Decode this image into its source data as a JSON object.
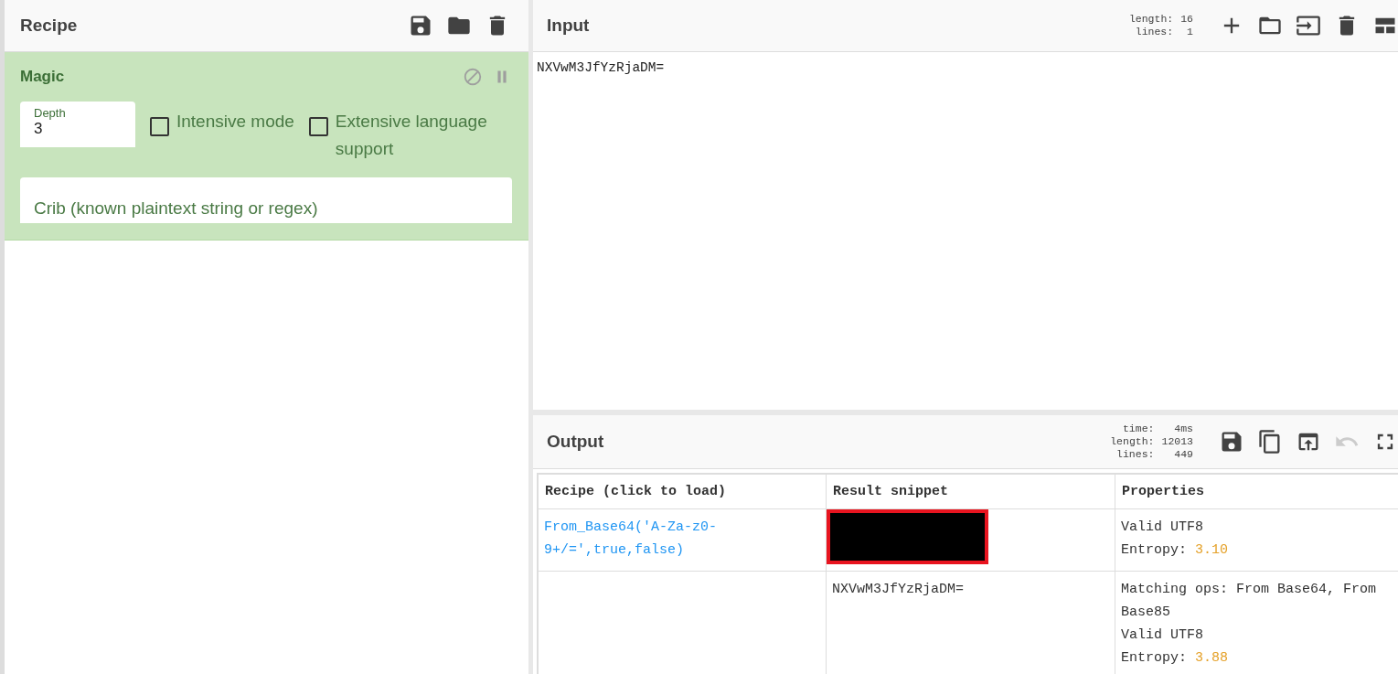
{
  "recipe": {
    "title": "Recipe",
    "operation": {
      "name": "Magic",
      "disabled": false,
      "paused": false,
      "depth": {
        "label": "Depth",
        "value": "3"
      },
      "checkboxes": [
        {
          "label": "Intensive mode",
          "checked": false
        },
        {
          "label": "Extensive language support",
          "checked": false
        }
      ],
      "crib": {
        "placeholder": "Crib (known plaintext string or regex)"
      }
    }
  },
  "input": {
    "title": "Input",
    "stats": [
      {
        "label": "length:",
        "value": "16"
      },
      {
        "label": "lines:",
        "value": "1"
      }
    ],
    "text": "NXVwM3JfYzRjaDM="
  },
  "output": {
    "title": "Output",
    "stats": [
      {
        "label": "time:",
        "value": "4ms"
      },
      {
        "label": "length:",
        "value": "12013"
      },
      {
        "label": "lines:",
        "value": "449"
      }
    ],
    "undo_disabled": true,
    "table": {
      "columns": [
        "Recipe (click to load)",
        "Result snippet",
        "Properties"
      ],
      "rows": [
        {
          "recipe": "From_Base64('A-Za-z0-9+/=',true,false)",
          "result": {
            "kind": "redacted"
          },
          "properties": [
            {
              "text": "Valid UTF8"
            },
            {
              "text": "Entropy:",
              "value": "3.10"
            }
          ]
        },
        {
          "recipe": "",
          "result": {
            "kind": "text",
            "text": "NXVwM3JfYzRjaDM="
          },
          "properties": [
            {
              "text": "Matching ops: From Base64, From Base85"
            },
            {
              "text": "Valid UTF8"
            },
            {
              "text": "Entropy:",
              "value": "3.88"
            }
          ]
        }
      ]
    }
  }
}
